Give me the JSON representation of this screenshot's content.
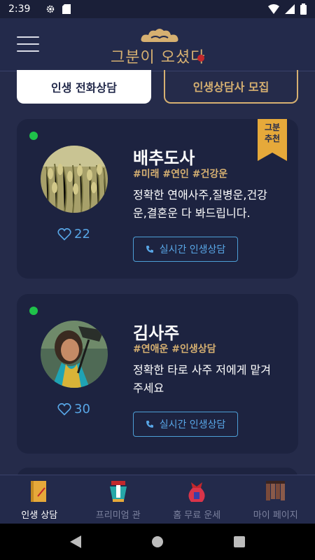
{
  "status_bar": {
    "time": "2:39"
  },
  "header": {
    "logo_text": "그분이 오셨다",
    "menu_icon": "hamburger-icon",
    "logo_icon": "cloud-icon"
  },
  "tabs": [
    {
      "label": "인생 전화상담",
      "active": true
    },
    {
      "label": "인생상담사 모집",
      "active": false
    }
  ],
  "counselors": [
    {
      "name": "배추도사",
      "tags": "#미래 #연인 #건강운",
      "description": "정확한 연애사주,질병운,건강운,결혼운 다 봐드립니다.",
      "likes": "22",
      "call_label": "실시간 인생상담",
      "badge": [
        "그분",
        "추천"
      ],
      "online": true
    },
    {
      "name": "김사주",
      "tags": "#연애운 #인생상담",
      "description": "정확한 타로 사주 저에게 맡겨주세요",
      "likes": "30",
      "call_label": "실시간 인생상담",
      "online": true
    }
  ],
  "bottom_nav": [
    {
      "label": "인생 상담",
      "icon": "counsel-book-icon",
      "active": true
    },
    {
      "label": "프리미엄 관",
      "icon": "premium-lantern-icon",
      "active": false
    },
    {
      "label": "홈 무료 운세",
      "icon": "fortune-pouch-icon",
      "active": false
    },
    {
      "label": "마이 페이지",
      "icon": "mypage-cards-icon",
      "active": false
    }
  ],
  "colors": {
    "background": "#252b4a",
    "card": "#1d2340",
    "gold": "#d6b071",
    "accent_blue": "#58a6e6",
    "online": "#1fc24a"
  }
}
